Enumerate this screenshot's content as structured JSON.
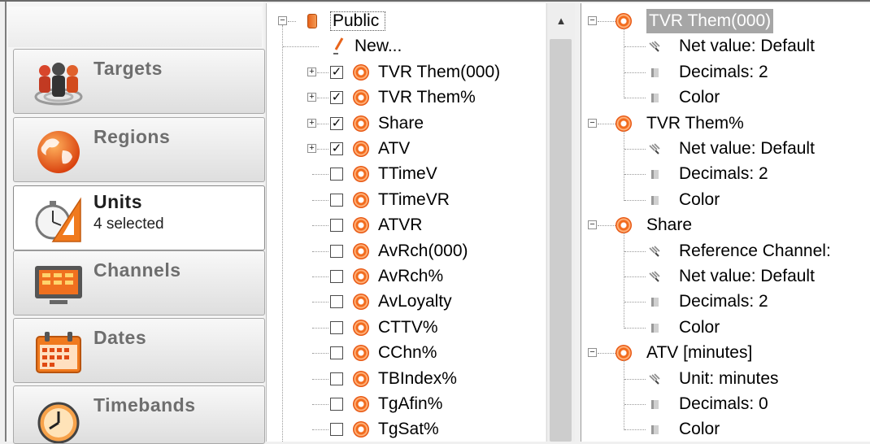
{
  "nav": {
    "items": [
      {
        "key": "targets",
        "label": "Targets",
        "sub": "",
        "icon": "targets-people-icon",
        "active": false
      },
      {
        "key": "regions",
        "label": "Regions",
        "sub": "",
        "icon": "globe-icon",
        "active": false
      },
      {
        "key": "units",
        "label": "Units",
        "sub": "4 selected",
        "icon": "stopwatch-ruler-icon",
        "active": true
      },
      {
        "key": "channels",
        "label": "Channels",
        "sub": "",
        "icon": "tv-icon",
        "active": false
      },
      {
        "key": "dates",
        "label": "Dates",
        "sub": "",
        "icon": "calendar-icon",
        "active": false
      },
      {
        "key": "timebands",
        "label": "Timebands",
        "sub": "",
        "icon": "clock-icon",
        "active": false
      }
    ]
  },
  "units_tree": {
    "root": {
      "label": "Public",
      "icon": "folder-icon"
    },
    "new_item": {
      "label": "New...",
      "icon": "pencil-icon"
    },
    "items": [
      {
        "label": "TVR Them(000)",
        "checked": true,
        "expandable": true
      },
      {
        "label": "TVR Them%",
        "checked": true,
        "expandable": true
      },
      {
        "label": "Share",
        "checked": true,
        "expandable": true
      },
      {
        "label": "ATV",
        "checked": true,
        "expandable": true
      },
      {
        "label": "TTimeV",
        "checked": false,
        "expandable": false
      },
      {
        "label": "TTimeVR",
        "checked": false,
        "expandable": false
      },
      {
        "label": "ATVR",
        "checked": false,
        "expandable": false
      },
      {
        "label": "AvRch(000)",
        "checked": false,
        "expandable": false
      },
      {
        "label": "AvRch%",
        "checked": false,
        "expandable": false
      },
      {
        "label": "AvLoyalty",
        "checked": false,
        "expandable": false
      },
      {
        "label": "CTTV%",
        "checked": false,
        "expandable": false
      },
      {
        "label": "CChn%",
        "checked": false,
        "expandable": false
      },
      {
        "label": "TBIndex%",
        "checked": false,
        "expandable": false
      },
      {
        "label": "TgAfin%",
        "checked": false,
        "expandable": false
      },
      {
        "label": "TgSat%",
        "checked": false,
        "expandable": false
      }
    ]
  },
  "selected_tree": {
    "groups": [
      {
        "label": "TVR Them(000)",
        "selected": true,
        "props": [
          {
            "label": "Net value: Default",
            "icon": "net-value-icon"
          },
          {
            "label": "Decimals: 2",
            "icon": "decimals-icon"
          },
          {
            "label": "Color",
            "icon": "color-icon"
          }
        ]
      },
      {
        "label": "TVR Them%",
        "selected": false,
        "props": [
          {
            "label": "Net value: Default",
            "icon": "net-value-icon"
          },
          {
            "label": "Decimals: 2",
            "icon": "decimals-icon"
          },
          {
            "label": "Color",
            "icon": "color-icon"
          }
        ]
      },
      {
        "label": "Share",
        "selected": false,
        "props": [
          {
            "label": "Reference Channel:",
            "icon": "reference-channel-icon"
          },
          {
            "label": "Net value: Default",
            "icon": "net-value-icon"
          },
          {
            "label": "Decimals: 2",
            "icon": "decimals-icon"
          },
          {
            "label": "Color",
            "icon": "color-icon"
          }
        ]
      },
      {
        "label": "ATV [minutes]",
        "selected": false,
        "props": [
          {
            "label": "Unit: minutes",
            "icon": "unit-icon"
          },
          {
            "label": "Decimals: 0",
            "icon": "decimals-icon"
          },
          {
            "label": "Color",
            "icon": "color-icon"
          }
        ]
      }
    ]
  },
  "colors": {
    "unit_orange": "#f26b1d",
    "selection_gray": "#a6a6a6"
  }
}
